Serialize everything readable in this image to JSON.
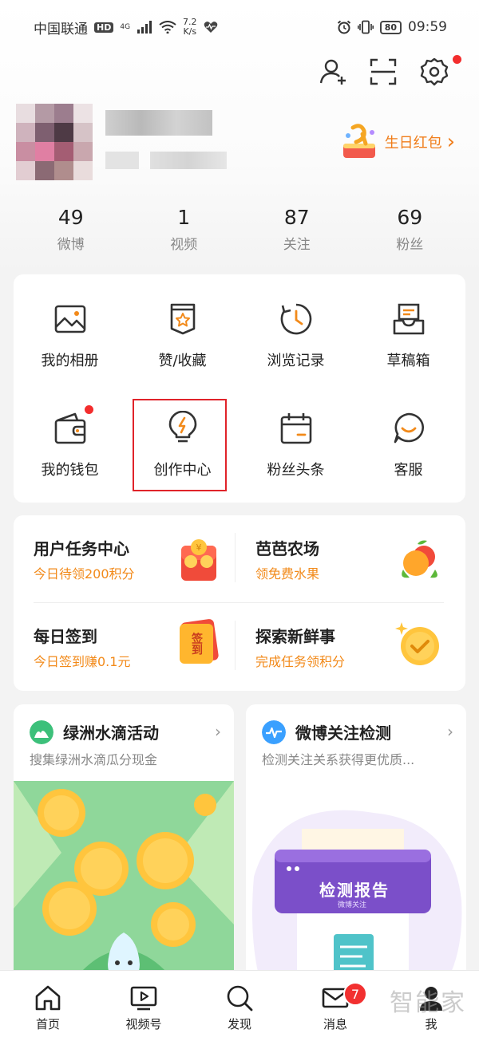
{
  "status_bar": {
    "carrier": "中国联通",
    "hd": "HD",
    "network": "4G",
    "speed_value": "7.2",
    "speed_unit": "K/s",
    "battery": "80",
    "time": "09:59"
  },
  "toolbar": {
    "icons": [
      "add-friend-icon",
      "scan-icon",
      "settings-icon"
    ],
    "settings_has_dot": true
  },
  "profile": {
    "birthday_label": "生日红包",
    "birthday_chevron": "›"
  },
  "stats": [
    {
      "value": "49",
      "label": "微博"
    },
    {
      "value": "1",
      "label": "视频"
    },
    {
      "value": "87",
      "label": "关注"
    },
    {
      "value": "69",
      "label": "粉丝"
    }
  ],
  "grid": [
    {
      "label": "我的相册",
      "icon": "album-icon"
    },
    {
      "label": "赞/收藏",
      "icon": "favorite-icon"
    },
    {
      "label": "浏览记录",
      "icon": "history-icon"
    },
    {
      "label": "草稿箱",
      "icon": "drafts-icon"
    },
    {
      "label": "我的钱包",
      "icon": "wallet-icon"
    },
    {
      "label": "创作中心",
      "icon": "creator-bulb-icon"
    },
    {
      "label": "粉丝头条",
      "icon": "calendar-icon"
    },
    {
      "label": "客服",
      "icon": "customer-service-icon"
    }
  ],
  "tasks": [
    {
      "title": "用户任务中心",
      "subtitle": "今日待领200积分"
    },
    {
      "title": "芭芭农场",
      "subtitle": "领免费水果"
    },
    {
      "title": "每日签到",
      "subtitle": "今日签到赚0.1元"
    },
    {
      "title": "探索新鲜事",
      "subtitle": "完成任务领积分"
    }
  ],
  "promos": [
    {
      "title": "绿洲水滴活动",
      "subtitle": "搜集绿洲水滴瓜分现金",
      "chevron": "›"
    },
    {
      "title": "微博关注检测",
      "subtitle": "检测关注关系获得更优质...",
      "chevron": "›",
      "report_title": "检测报告",
      "report_sub": "微博关注"
    }
  ],
  "signin_badge": "签到",
  "bottom_nav": [
    {
      "label": "首页",
      "icon": "home-icon"
    },
    {
      "label": "视频号",
      "icon": "video-icon"
    },
    {
      "label": "发现",
      "icon": "search-icon"
    },
    {
      "label": "消息",
      "icon": "message-icon",
      "badge": "7"
    },
    {
      "label": "我",
      "icon": "profile-icon"
    }
  ],
  "watermark": "智能家",
  "colors": {
    "accent_orange": "#f28a1a",
    "highlight_red": "#e0232a",
    "badge_red": "#f23030"
  }
}
